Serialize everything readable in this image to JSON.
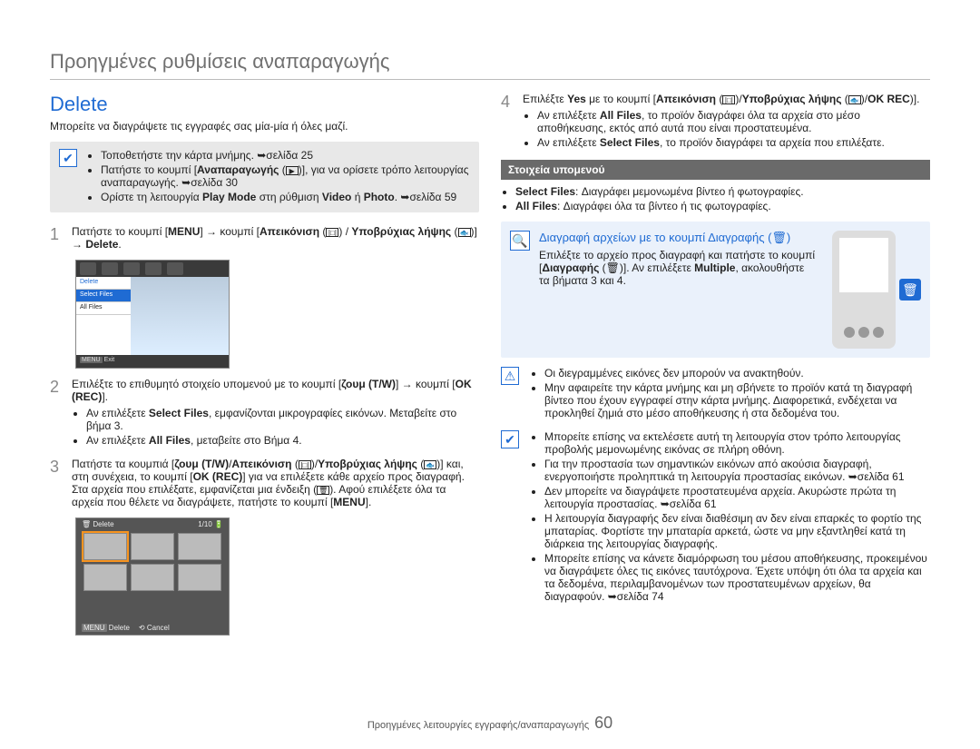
{
  "heading": "Προηγμένες ρυθμίσεις αναπαραγωγής",
  "title_blue": "Delete",
  "intro": "Μπορείτε να διαγράψετε τις εγγραφές σας μία-μία ή όλες μαζί.",
  "greybox": {
    "l1": "Τοποθετήστε την κάρτα μνήμης. ➥σελίδα 25",
    "l2a": "Πατήστε το κουμπί [",
    "l2b_bold": "Αναπαραγωγής",
    "l2c": " (",
    "l2d": ")], για να ορίσετε τρόπο λειτουργίας αναπαραγωγής. ➥σελίδα 30",
    "l3a": "Ορίστε τη λειτουργία ",
    "l3b_bold": "Play Mode",
    "l3c": " στη ρύθμιση ",
    "l3d_bold": "Video",
    "l3e": " ή ",
    "l3f_bold": "Photo",
    "l3g": ". ➥σελίδα 59"
  },
  "step1": {
    "a": "Πατήστε το κουμπί [",
    "menu": "MENU",
    "b": "] → κουμπί [",
    "disp": "Απεικόνιση",
    "c": " (",
    "d": ") / ",
    "under": "Υποβρύχιας λήψης",
    "e": " (",
    "f": ")] → ",
    "del": "Delete",
    "g": "."
  },
  "scr1": {
    "hdr": "Delete",
    "sel": "Select Files",
    "all": "All Files",
    "exit": "Exit"
  },
  "step2": {
    "a": "Επιλέξτε το επιθυμητό στοιχείο υπομενού με το κουμπί [",
    "zoom": "ζουμ (T/W)",
    "b": "] → κουμπί [",
    "ok": "OK (REC)",
    "c": "].",
    "bul1a": "Αν επιλέξετε ",
    "bul1b": "Select Files",
    "bul1c": ", εμφανίζονται μικρογραφίες εικόνων. Μεταβείτε στο βήμα 3.",
    "bul2a": "Αν επιλέξετε ",
    "bul2b": "All Files",
    "bul2c": ", μεταβείτε στο Βήμα 4."
  },
  "step3": {
    "a": "Πατήστε τα κουμπιά [",
    "zoom": "ζουμ (T/W)",
    "slash": "/",
    "disp": "Απεικόνιση",
    "b": " (",
    "c": ")/",
    "under": "Υποβρύχιας λήψης",
    "d": " (",
    "e": ")] και, στη συνέχεια, το κουμπί [",
    "ok": "OK (REC)",
    "f": "] για να επιλέξετε κάθε αρχείο προς διαγραφή. Στα αρχεία που επιλέξατε, εμφανίζεται μια ένδειξη (",
    "g": "). Αφού επιλέξετε όλα τα αρχεία που θέλετε να διαγράψετε, πατήστε το κουμπί [",
    "menu": "MENU",
    "h": "]."
  },
  "scr2": {
    "title": "Delete",
    "count": "1/10",
    "del": "Delete",
    "cancel": "Cancel"
  },
  "step4": {
    "a": "Επιλέξτε ",
    "yes": "Yes",
    "b": " με το κουμπί [",
    "disp": "Απεικόνιση",
    "c": " (",
    "d": ")/",
    "under": "Υποβρύχιας λήψης",
    "e": " (",
    "f": ")/",
    "ok": "OK REC",
    "g": ")].",
    "bul1a": "Αν επιλέξετε ",
    "bul1b": "All Files",
    "bul1c": ", το προϊόν διαγράφει όλα τα αρχεία στο μέσο αποθήκευσης, εκτός από αυτά που είναι προστατευμένα.",
    "bul2a": "Αν επιλέξετε ",
    "bul2b": "Select Files",
    "bul2c": ", το προϊόν διαγράφει τα αρχεία που επιλέξατε."
  },
  "submenu": {
    "header": "Στοιχεία υπομενού",
    "l1a": "Select Files",
    "l1b": ": Διαγράφει μεμονωμένα βίντεο ή φωτογραφίες.",
    "l2a": "All Files",
    "l2b": ": Διαγράφει όλα τα βίντεο ή τις φωτογραφίες."
  },
  "tip": {
    "title": "Διαγραφή αρχείων με το κουμπί Διαγραφής (🗑)",
    "p1a": "Επιλέξτε το αρχείο προς διαγραφή και πατήστε το κουμπί [",
    "p1b": "Διαγραφής",
    "p1c": " (🗑)]. Αν επιλέξετε ",
    "p1d": "Multiple",
    "p1e": ", ακολουθήστε τα βήματα 3 και 4."
  },
  "warn": {
    "l1": "Οι διεγραμμένες εικόνες δεν μπορούν να ανακτηθούν.",
    "l2": "Μην αφαιρείτε την κάρτα μνήμης και μη σβήνετε το προϊόν κατά τη διαγραφή βίντεο που έχουν εγγραφεί στην κάρτα μνήμης. Διαφορετικά, ενδέχεται να προκληθεί ζημιά στο μέσο αποθήκευσης ή στα δεδομένα του."
  },
  "note": {
    "l1": "Μπορείτε επίσης να εκτελέσετε αυτή τη λειτουργία στον τρόπο λειτουργίας προβολής μεμονωμένης εικόνας σε πλήρη οθόνη.",
    "l2": "Για την προστασία των σημαντικών εικόνων από ακούσια διαγραφή, ενεργοποιήστε προληπτικά τη λειτουργία προστασίας εικόνων. ➥σελίδα 61",
    "l3": "Δεν μπορείτε να διαγράψετε προστατευμένα αρχεία. Ακυρώστε πρώτα τη λειτουργία προστασίας. ➥σελίδα 61",
    "l4": "Η λειτουργία διαγραφής δεν είναι διαθέσιμη αν δεν είναι επαρκές το φορτίο της μπαταρίας. Φορτίστε την μπαταρία αρκετά, ώστε να μην εξαντληθεί κατά τη διάρκεια της λειτουργίας διαγραφής.",
    "l5": "Μπορείτε επίσης να κάνετε διαμόρφωση του μέσου αποθήκευσης, προκειμένου να διαγράψετε όλες τις εικόνες ταυτόχρονα. Έχετε υπόψη ότι όλα τα αρχεία και τα δεδομένα, περιλαμβανομένων των προστατευμένων αρχείων, θα διαγραφούν. ➥σελίδα 74"
  },
  "footer": {
    "text": "Προηγμένες λειτουργίες εγγραφής/αναπαραγωγής",
    "page": "60"
  }
}
